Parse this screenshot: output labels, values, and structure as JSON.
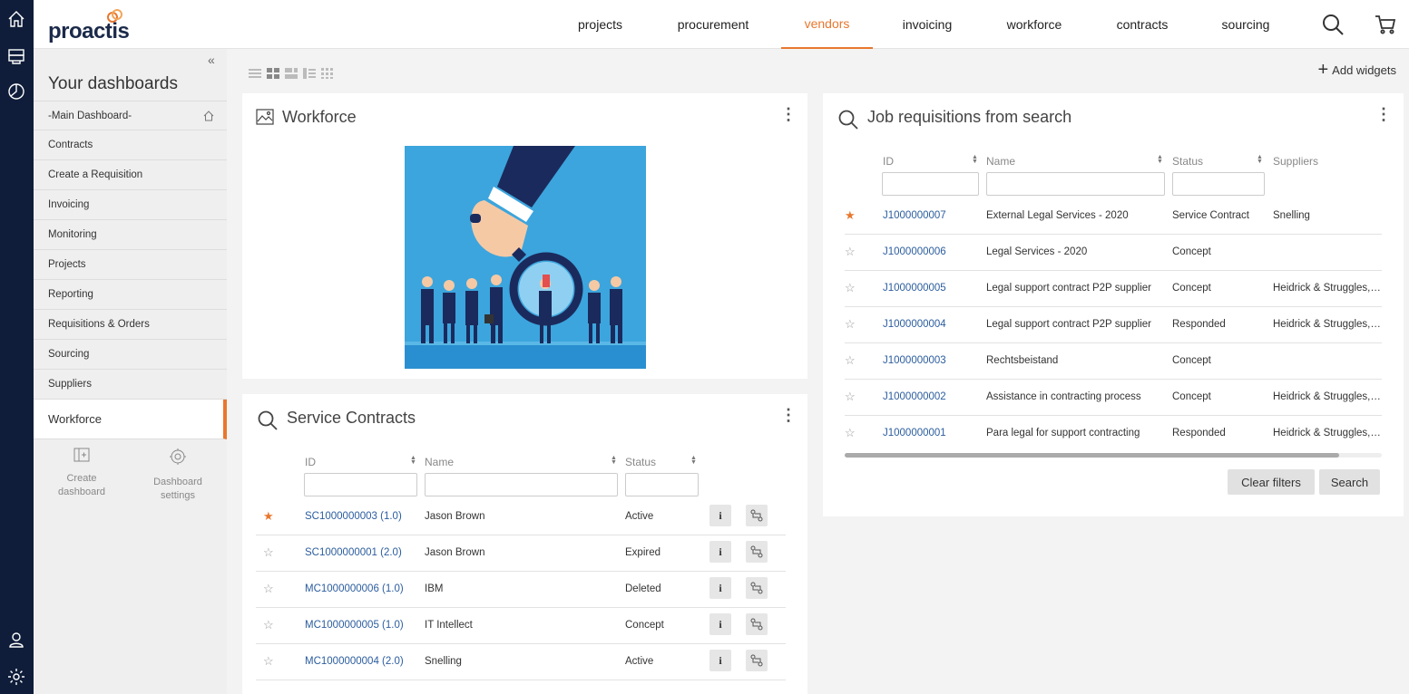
{
  "app": {
    "logo_text": "proactis"
  },
  "nav": {
    "items": [
      {
        "label": "projects"
      },
      {
        "label": "procurement"
      },
      {
        "label": "vendors"
      },
      {
        "label": "invoicing"
      },
      {
        "label": "workforce"
      },
      {
        "label": "contracts"
      },
      {
        "label": "sourcing"
      }
    ],
    "active": "vendors"
  },
  "rail": {
    "icons": [
      "home-icon",
      "inbox-icon",
      "reports-icon",
      "user-icon",
      "settings-icon"
    ]
  },
  "sidebar": {
    "title": "Your dashboards",
    "items": [
      {
        "label": "-Main Dashboard-"
      },
      {
        "label": "Contracts"
      },
      {
        "label": "Create a Requisition"
      },
      {
        "label": "Invoicing"
      },
      {
        "label": "Monitoring"
      },
      {
        "label": "Projects"
      },
      {
        "label": "Reporting"
      },
      {
        "label": "Requisitions & Orders"
      },
      {
        "label": "Sourcing"
      },
      {
        "label": "Suppliers"
      },
      {
        "label": "Workforce"
      }
    ],
    "active": "Workforce",
    "create_label_1": "Create",
    "create_label_2": "dashboard",
    "settings_label_1": "Dashboard",
    "settings_label_2": "settings"
  },
  "toolbar": {
    "add_widgets": "Add widgets"
  },
  "workforce_widget": {
    "title": "Workforce"
  },
  "service_contracts": {
    "title": "Service Contracts",
    "columns": [
      "ID",
      "Name",
      "Status"
    ],
    "rows": [
      {
        "starred": true,
        "id": "SC1000000003 (1.0)",
        "name": "Jason Brown",
        "status": "Active"
      },
      {
        "starred": false,
        "id": "SC1000000001 (2.0)",
        "name": "Jason Brown",
        "status": "Expired"
      },
      {
        "starred": false,
        "id": "MC1000000006 (1.0)",
        "name": "IBM",
        "status": "Deleted"
      },
      {
        "starred": false,
        "id": "MC1000000005 (1.0)",
        "name": "IT Intellect",
        "status": "Concept"
      },
      {
        "starred": false,
        "id": "MC1000000004 (2.0)",
        "name": "Snelling",
        "status": "Active"
      }
    ],
    "info_label": "i"
  },
  "job_requisitions": {
    "title": "Job requisitions from search",
    "columns": [
      "ID",
      "Name",
      "Status",
      "Suppliers"
    ],
    "rows": [
      {
        "starred": true,
        "id": "J1000000007",
        "name": "External Legal Services - 2020",
        "status": "Service Contract",
        "suppliers": "Snelling"
      },
      {
        "starred": false,
        "id": "J1000000006",
        "name": "Legal Services - 2020",
        "status": "Concept",
        "suppliers": ""
      },
      {
        "starred": false,
        "id": "J1000000005",
        "name": "Legal support contract P2P supplier",
        "status": "Concept",
        "suppliers": "Heidrick & Struggles, R.."
      },
      {
        "starred": false,
        "id": "J1000000004",
        "name": "Legal support contract P2P supplier",
        "status": "Responded",
        "suppliers": "Heidrick & Struggles, R.."
      },
      {
        "starred": false,
        "id": "J1000000003",
        "name": "Rechtsbeistand",
        "status": "Concept",
        "suppliers": ""
      },
      {
        "starred": false,
        "id": "J1000000002",
        "name": "Assistance in contracting process",
        "status": "Concept",
        "suppliers": "Heidrick & Struggles, R.."
      },
      {
        "starred": false,
        "id": "J1000000001",
        "name": "Para legal for support contracting",
        "status": "Responded",
        "suppliers": "Heidrick & Struggles, R.."
      }
    ],
    "clear_filters": "Clear filters",
    "search": "Search"
  },
  "colors": {
    "accent": "#e8772e",
    "rail": "#0f1d3a",
    "link": "#2b5d9e"
  }
}
